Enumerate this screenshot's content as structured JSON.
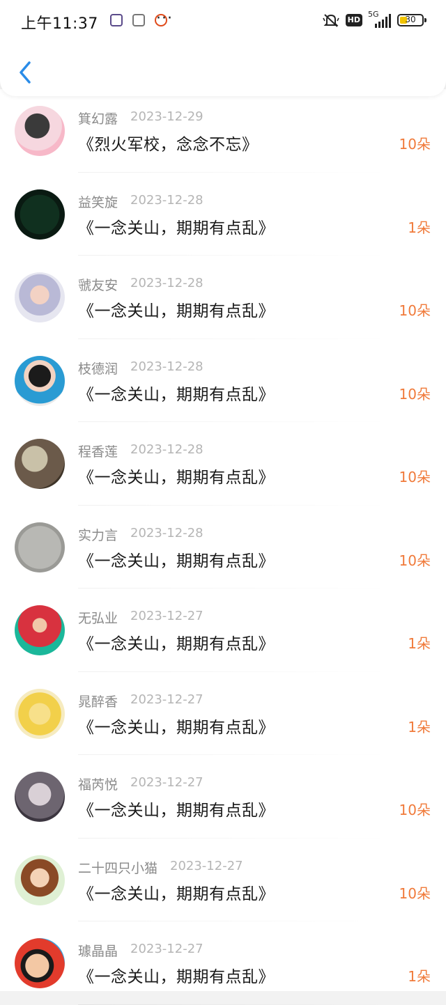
{
  "status_bar": {
    "time": "上午11:37",
    "more": "···",
    "hd": "HD",
    "network": "5G",
    "battery": "30"
  },
  "colors": {
    "accent": "#2a8ce8",
    "amount": "#f07a3a",
    "name": "#8a8a8a",
    "date": "#b5b5b5"
  },
  "records": [
    {
      "name": "箕幻露",
      "date": "2023-12-29",
      "book": "《烈火军校，念念不忘》",
      "amount": "10朵"
    },
    {
      "name": "益笑旋",
      "date": "2023-12-28",
      "book": "《一念关山，期期有点乱》",
      "amount": "1朵"
    },
    {
      "name": "虢友安",
      "date": "2023-12-28",
      "book": "《一念关山，期期有点乱》",
      "amount": "10朵"
    },
    {
      "name": "枝德润",
      "date": "2023-12-28",
      "book": "《一念关山，期期有点乱》",
      "amount": "10朵"
    },
    {
      "name": "程香莲",
      "date": "2023-12-28",
      "book": "《一念关山，期期有点乱》",
      "amount": "10朵"
    },
    {
      "name": "实力言",
      "date": "2023-12-28",
      "book": "《一念关山，期期有点乱》",
      "amount": "10朵"
    },
    {
      "name": "无弘业",
      "date": "2023-12-27",
      "book": "《一念关山，期期有点乱》",
      "amount": "1朵"
    },
    {
      "name": "晁醉香",
      "date": "2023-12-27",
      "book": "《一念关山，期期有点乱》",
      "amount": "1朵"
    },
    {
      "name": "福芮悦",
      "date": "2023-12-27",
      "book": "《一念关山，期期有点乱》",
      "amount": "10朵"
    },
    {
      "name": "二十四只小猫",
      "date": "2023-12-27",
      "book": "《一念关山，期期有点乱》",
      "amount": "10朵"
    },
    {
      "name": "璩晶晶",
      "date": "2023-12-27",
      "book": "《一念关山，期期有点乱》",
      "amount": "1朵"
    }
  ]
}
